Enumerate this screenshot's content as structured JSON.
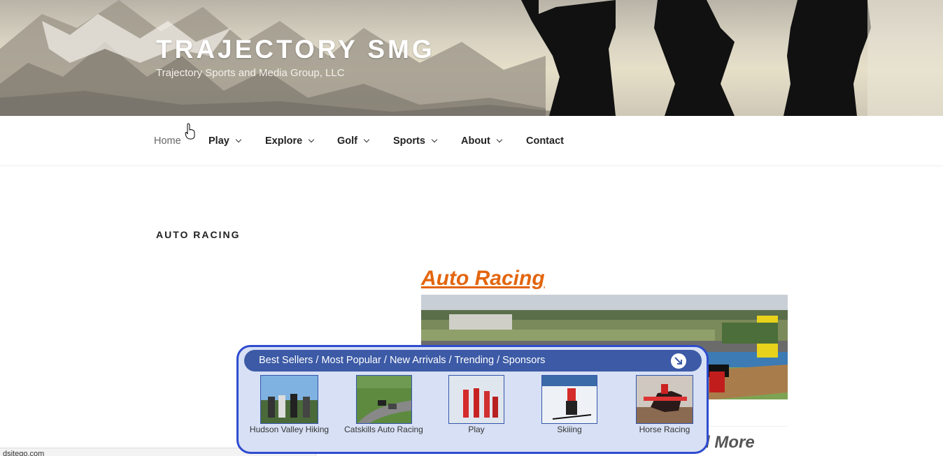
{
  "header": {
    "site_title": "TRAJECTORY SMG",
    "tagline": "Trajectory Sports and Media Group, LLC"
  },
  "nav": {
    "items": [
      {
        "label": "Home",
        "has_dropdown": false
      },
      {
        "label": "Play",
        "has_dropdown": true
      },
      {
        "label": "Explore",
        "has_dropdown": true
      },
      {
        "label": "Golf",
        "has_dropdown": true
      },
      {
        "label": "Sports",
        "has_dropdown": true
      },
      {
        "label": "About",
        "has_dropdown": true
      },
      {
        "label": "Contact",
        "has_dropdown": false
      }
    ]
  },
  "content": {
    "page_heading": "AUTO RACING",
    "post_title": "Auto Racing",
    "read_more": "d More"
  },
  "statusbar": {
    "text": "dsitego.com"
  },
  "widget": {
    "title": "Best Sellers / Most Popular / New Arrivals / Trending / Sponsors",
    "items": [
      {
        "label": "Hudson Valley Hiking"
      },
      {
        "label": "Catskills Auto Racing"
      },
      {
        "label": "Play"
      },
      {
        "label": "Skiiing"
      },
      {
        "label": "Horse Racing"
      }
    ]
  },
  "colors": {
    "accent_orange": "#e3650d",
    "widget_border": "#2f4ccf",
    "widget_bar": "#3c5aa6",
    "widget_bg": "#d7e0f5"
  }
}
